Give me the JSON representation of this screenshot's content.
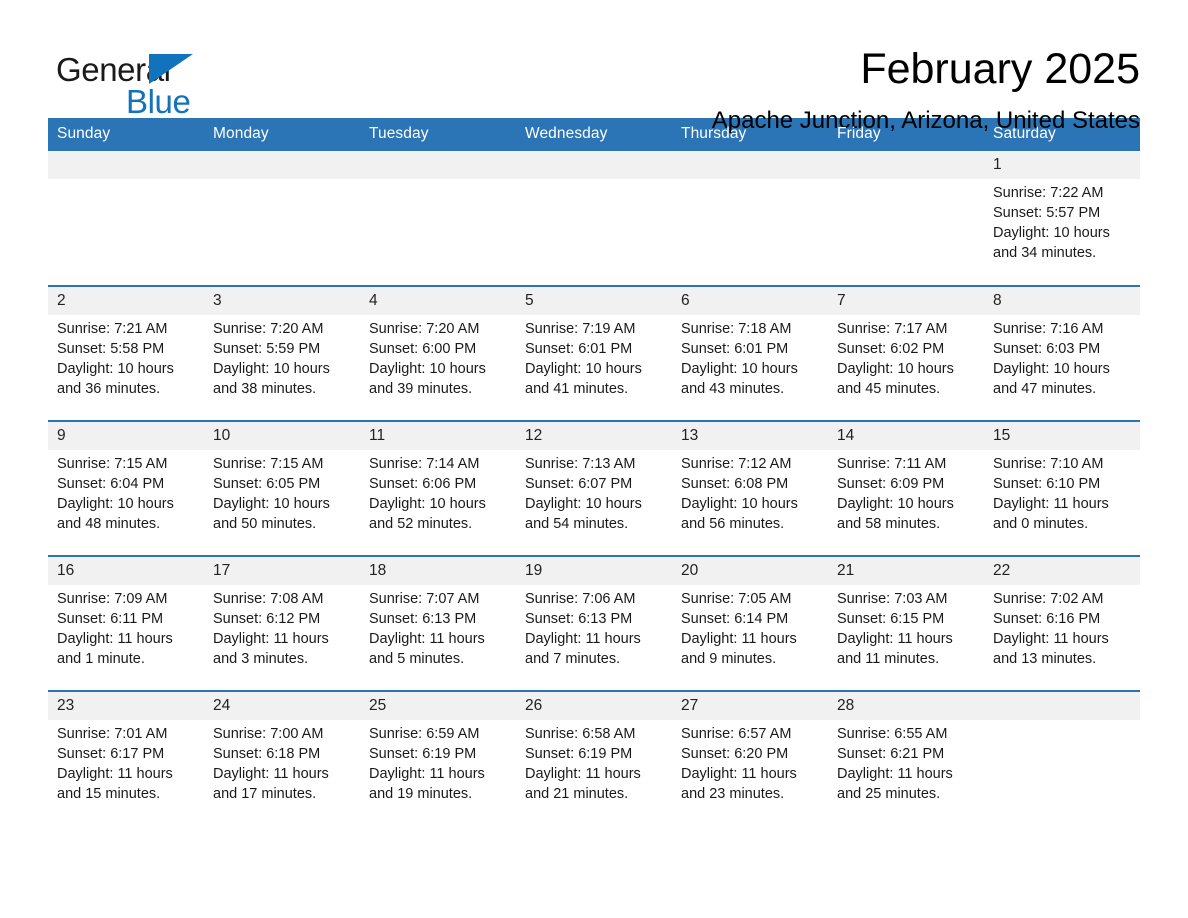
{
  "brand": {
    "word_one": "General",
    "word_two": "Blue",
    "triangle_icon": "brand-triangle-icon",
    "accent_color": "#1273bd"
  },
  "header": {
    "month_title": "February 2025",
    "location": "Apache Junction, Arizona, United States"
  },
  "theme": {
    "header_blue": "#2b74b5",
    "daynum_band": "#f1f1f1",
    "text": "#1a1a1a"
  },
  "weekday_headers": [
    "Sunday",
    "Monday",
    "Tuesday",
    "Wednesday",
    "Thursday",
    "Friday",
    "Saturday"
  ],
  "weeks": [
    [
      {
        "day": "",
        "empty": true
      },
      {
        "day": "",
        "empty": true
      },
      {
        "day": "",
        "empty": true
      },
      {
        "day": "",
        "empty": true
      },
      {
        "day": "",
        "empty": true
      },
      {
        "day": "",
        "empty": true
      },
      {
        "day": "1",
        "sunrise": "Sunrise: 7:22 AM",
        "sunset": "Sunset: 5:57 PM",
        "daylight": "Daylight: 10 hours and 34 minutes."
      }
    ],
    [
      {
        "day": "2",
        "sunrise": "Sunrise: 7:21 AM",
        "sunset": "Sunset: 5:58 PM",
        "daylight": "Daylight: 10 hours and 36 minutes."
      },
      {
        "day": "3",
        "sunrise": "Sunrise: 7:20 AM",
        "sunset": "Sunset: 5:59 PM",
        "daylight": "Daylight: 10 hours and 38 minutes."
      },
      {
        "day": "4",
        "sunrise": "Sunrise: 7:20 AM",
        "sunset": "Sunset: 6:00 PM",
        "daylight": "Daylight: 10 hours and 39 minutes."
      },
      {
        "day": "5",
        "sunrise": "Sunrise: 7:19 AM",
        "sunset": "Sunset: 6:01 PM",
        "daylight": "Daylight: 10 hours and 41 minutes."
      },
      {
        "day": "6",
        "sunrise": "Sunrise: 7:18 AM",
        "sunset": "Sunset: 6:01 PM",
        "daylight": "Daylight: 10 hours and 43 minutes."
      },
      {
        "day": "7",
        "sunrise": "Sunrise: 7:17 AM",
        "sunset": "Sunset: 6:02 PM",
        "daylight": "Daylight: 10 hours and 45 minutes."
      },
      {
        "day": "8",
        "sunrise": "Sunrise: 7:16 AM",
        "sunset": "Sunset: 6:03 PM",
        "daylight": "Daylight: 10 hours and 47 minutes."
      }
    ],
    [
      {
        "day": "9",
        "sunrise": "Sunrise: 7:15 AM",
        "sunset": "Sunset: 6:04 PM",
        "daylight": "Daylight: 10 hours and 48 minutes."
      },
      {
        "day": "10",
        "sunrise": "Sunrise: 7:15 AM",
        "sunset": "Sunset: 6:05 PM",
        "daylight": "Daylight: 10 hours and 50 minutes."
      },
      {
        "day": "11",
        "sunrise": "Sunrise: 7:14 AM",
        "sunset": "Sunset: 6:06 PM",
        "daylight": "Daylight: 10 hours and 52 minutes."
      },
      {
        "day": "12",
        "sunrise": "Sunrise: 7:13 AM",
        "sunset": "Sunset: 6:07 PM",
        "daylight": "Daylight: 10 hours and 54 minutes."
      },
      {
        "day": "13",
        "sunrise": "Sunrise: 7:12 AM",
        "sunset": "Sunset: 6:08 PM",
        "daylight": "Daylight: 10 hours and 56 minutes."
      },
      {
        "day": "14",
        "sunrise": "Sunrise: 7:11 AM",
        "sunset": "Sunset: 6:09 PM",
        "daylight": "Daylight: 10 hours and 58 minutes."
      },
      {
        "day": "15",
        "sunrise": "Sunrise: 7:10 AM",
        "sunset": "Sunset: 6:10 PM",
        "daylight": "Daylight: 11 hours and 0 minutes."
      }
    ],
    [
      {
        "day": "16",
        "sunrise": "Sunrise: 7:09 AM",
        "sunset": "Sunset: 6:11 PM",
        "daylight": "Daylight: 11 hours and 1 minute."
      },
      {
        "day": "17",
        "sunrise": "Sunrise: 7:08 AM",
        "sunset": "Sunset: 6:12 PM",
        "daylight": "Daylight: 11 hours and 3 minutes."
      },
      {
        "day": "18",
        "sunrise": "Sunrise: 7:07 AM",
        "sunset": "Sunset: 6:13 PM",
        "daylight": "Daylight: 11 hours and 5 minutes."
      },
      {
        "day": "19",
        "sunrise": "Sunrise: 7:06 AM",
        "sunset": "Sunset: 6:13 PM",
        "daylight": "Daylight: 11 hours and 7 minutes."
      },
      {
        "day": "20",
        "sunrise": "Sunrise: 7:05 AM",
        "sunset": "Sunset: 6:14 PM",
        "daylight": "Daylight: 11 hours and 9 minutes."
      },
      {
        "day": "21",
        "sunrise": "Sunrise: 7:03 AM",
        "sunset": "Sunset: 6:15 PM",
        "daylight": "Daylight: 11 hours and 11 minutes."
      },
      {
        "day": "22",
        "sunrise": "Sunrise: 7:02 AM",
        "sunset": "Sunset: 6:16 PM",
        "daylight": "Daylight: 11 hours and 13 minutes."
      }
    ],
    [
      {
        "day": "23",
        "sunrise": "Sunrise: 7:01 AM",
        "sunset": "Sunset: 6:17 PM",
        "daylight": "Daylight: 11 hours and 15 minutes."
      },
      {
        "day": "24",
        "sunrise": "Sunrise: 7:00 AM",
        "sunset": "Sunset: 6:18 PM",
        "daylight": "Daylight: 11 hours and 17 minutes."
      },
      {
        "day": "25",
        "sunrise": "Sunrise: 6:59 AM",
        "sunset": "Sunset: 6:19 PM",
        "daylight": "Daylight: 11 hours and 19 minutes."
      },
      {
        "day": "26",
        "sunrise": "Sunrise: 6:58 AM",
        "sunset": "Sunset: 6:19 PM",
        "daylight": "Daylight: 11 hours and 21 minutes."
      },
      {
        "day": "27",
        "sunrise": "Sunrise: 6:57 AM",
        "sunset": "Sunset: 6:20 PM",
        "daylight": "Daylight: 11 hours and 23 minutes."
      },
      {
        "day": "28",
        "sunrise": "Sunrise: 6:55 AM",
        "sunset": "Sunset: 6:21 PM",
        "daylight": "Daylight: 11 hours and 25 minutes."
      },
      {
        "day": "",
        "empty": true
      }
    ]
  ]
}
